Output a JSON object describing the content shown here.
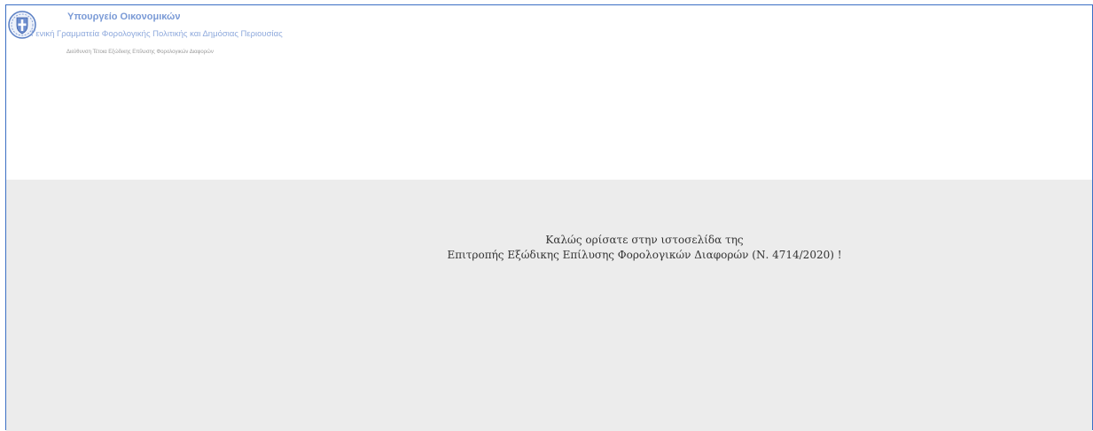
{
  "header": {
    "logo_icon": "greek-coat-of-arms-icon",
    "ministry": "Υπουργείο Οικονομικών",
    "secretariat": "Γενική Γραμματεία Φορολογικής Πολιτικής και Δημόσιας Περιουσίας",
    "directorate": "Διεύθυνση Τέτοια Εξώδικης Επίλυσης Φορολογικών Διαφορών"
  },
  "main": {
    "welcome_line1": "Καλώς ορίσατε στην ιστοσελίδα της",
    "welcome_line2": "Επιτροπής Εξώδικης Επίλυσης Φορολογικών Διαφορών (Ν. 4714/2020) !"
  },
  "colors": {
    "accent": "#3b6fc4",
    "header_text": "#7a9ad6",
    "content_bg": "#ececec"
  }
}
